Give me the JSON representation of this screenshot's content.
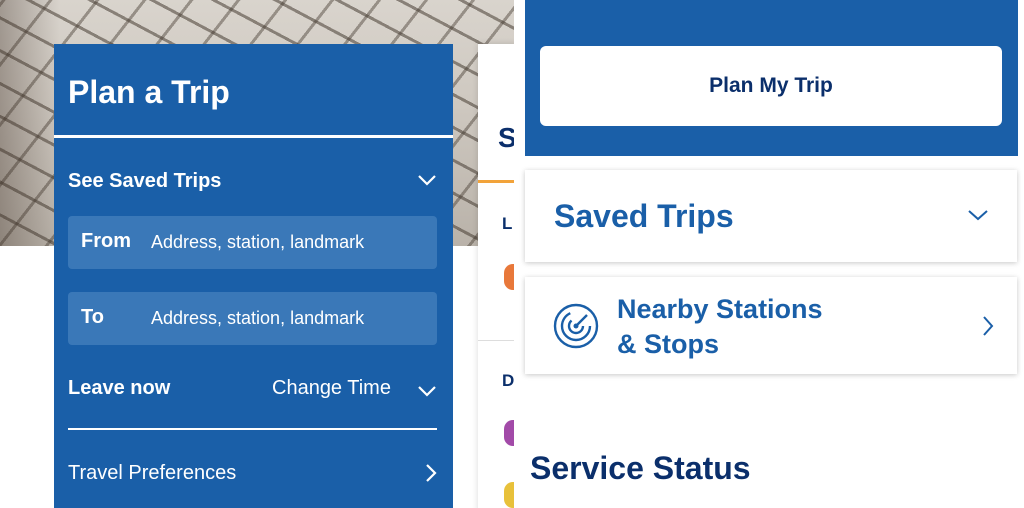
{
  "left": {
    "title": "Plan a Trip",
    "saved_trips_label": "See Saved Trips",
    "from": {
      "label": "From",
      "placeholder": "Address, station, landmark"
    },
    "to": {
      "label": "To",
      "placeholder": "Address, station, landmark"
    },
    "leave_now_label": "Leave now",
    "change_time_label": "Change Time",
    "travel_preferences_label": "Travel Preferences",
    "background_peek": {
      "heading_initial": "S",
      "section1_initial": "L",
      "section2_initial": "D"
    }
  },
  "right": {
    "plan_button_label": "Plan My Trip",
    "saved_trips_title": "Saved Trips",
    "nearby_title_line1": "Nearby Stations",
    "nearby_title_line2": "& Stops",
    "service_status_title": "Service Status"
  },
  "icons": {
    "saved_trips_chevron": "chevron-down-icon",
    "change_time_chevron": "chevron-down-icon",
    "travel_prefs_chevron": "chevron-right-icon",
    "nearby_icon": "radar-icon",
    "nearby_chevron": "chevron-right-icon"
  },
  "colors": {
    "primary_blue": "#1a5fa8",
    "field_blue": "#3a78b8",
    "navy_text": "#0b2f6b",
    "accent_orange": "#f2a33a"
  }
}
